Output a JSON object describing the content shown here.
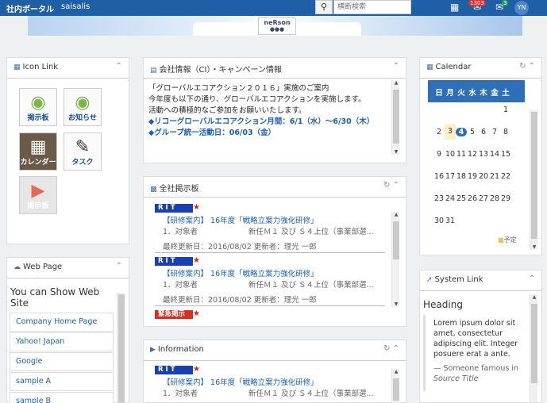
{
  "topbar": {
    "brand": "社内ポータル",
    "user": "saisalis",
    "search_placeholder": "横断検索",
    "mail_count": "1303",
    "notify_count": "3",
    "avatar": "YN"
  },
  "banner": {
    "logo": "neRson"
  },
  "iconlink": {
    "title": "Icon Link",
    "items": [
      {
        "label": "掲示板",
        "icon": "bulletin-icon"
      },
      {
        "label": "お知らせ",
        "icon": "notice-icon"
      },
      {
        "label": "カレンダー",
        "icon": "calendar-icon"
      },
      {
        "label": "タスク",
        "icon": "task-icon"
      },
      {
        "label": "掲示板",
        "icon": "megaphone-icon"
      }
    ]
  },
  "webpage": {
    "title": "Web Page",
    "heading": "You can Show Web Site",
    "links": [
      "Company Home Page",
      "Yahoo! Japan",
      "Google",
      "sample A",
      "sample B"
    ]
  },
  "company": {
    "title": "会社情報（CI）・キャンペーン情報",
    "lines": [
      "「グローバルエコアクション２０１６」実施のご案内",
      "今年度も以下の通り、グローバルエコアクションを実施します。",
      "活動への積極的なご参加をお願いいたします。"
    ],
    "bullets": [
      "◆リコーグローバルエコアクション月間：6/1（水）～6/30（木）",
      "◆グループ統一活動日：06/03（金）"
    ]
  },
  "bulletin": {
    "title": "全社掲示板",
    "posts": [
      {
        "tag": "RIT",
        "title": "【研修案内】 16年度「戦略立案力強化研修」",
        "body1": "1．対象者",
        "body2": "新任Ｍ１ 及び Ｓ４上位（事業部選...",
        "meta": "最終更新日：2016/08/02 更新者：理光 一郎"
      },
      {
        "tag": "RIT",
        "title": "【研修案内】 16年度「戦略立案力強化研修」",
        "body1": "1．対象者",
        "body2": "新任Ｍ１ 及び Ｓ４上位（事業部選...",
        "meta": "最終更新日：2016/08/02 更新者：理光 一郎"
      },
      {
        "tag": "緊急掲示"
      }
    ]
  },
  "information": {
    "title": "Information",
    "posts": [
      {
        "tag": "RIT",
        "title": "【研修案内】 16年度「戦略立案力強化研修」",
        "body1": "1．対象者",
        "body2": "新任Ｍ１ 及び Ｓ４上位（事業部選..."
      }
    ]
  },
  "calendar": {
    "title": "Calendar",
    "weekdays": [
      "日",
      "月",
      "火",
      "水",
      "木",
      "金",
      "土"
    ],
    "days": [
      "1",
      "2",
      "3",
      "4",
      "5",
      "6",
      "7",
      "8",
      "9",
      "10",
      "11",
      "12",
      "13",
      "14",
      "15",
      "16",
      "17",
      "18",
      "19",
      "20",
      "21",
      "22",
      "23",
      "24",
      "25",
      "26",
      "27",
      "28",
      "29",
      "30",
      "31"
    ],
    "today": "4",
    "legend": "予定"
  },
  "systemlink": {
    "title": "System Link",
    "heading": "Heading",
    "quote": "Lorem ipsum dolor sit amet, consectetur adipiscing elit. Integer posuere erat a ante.",
    "cite_prefix": "— Someone famous in ",
    "cite": "Source Title"
  }
}
